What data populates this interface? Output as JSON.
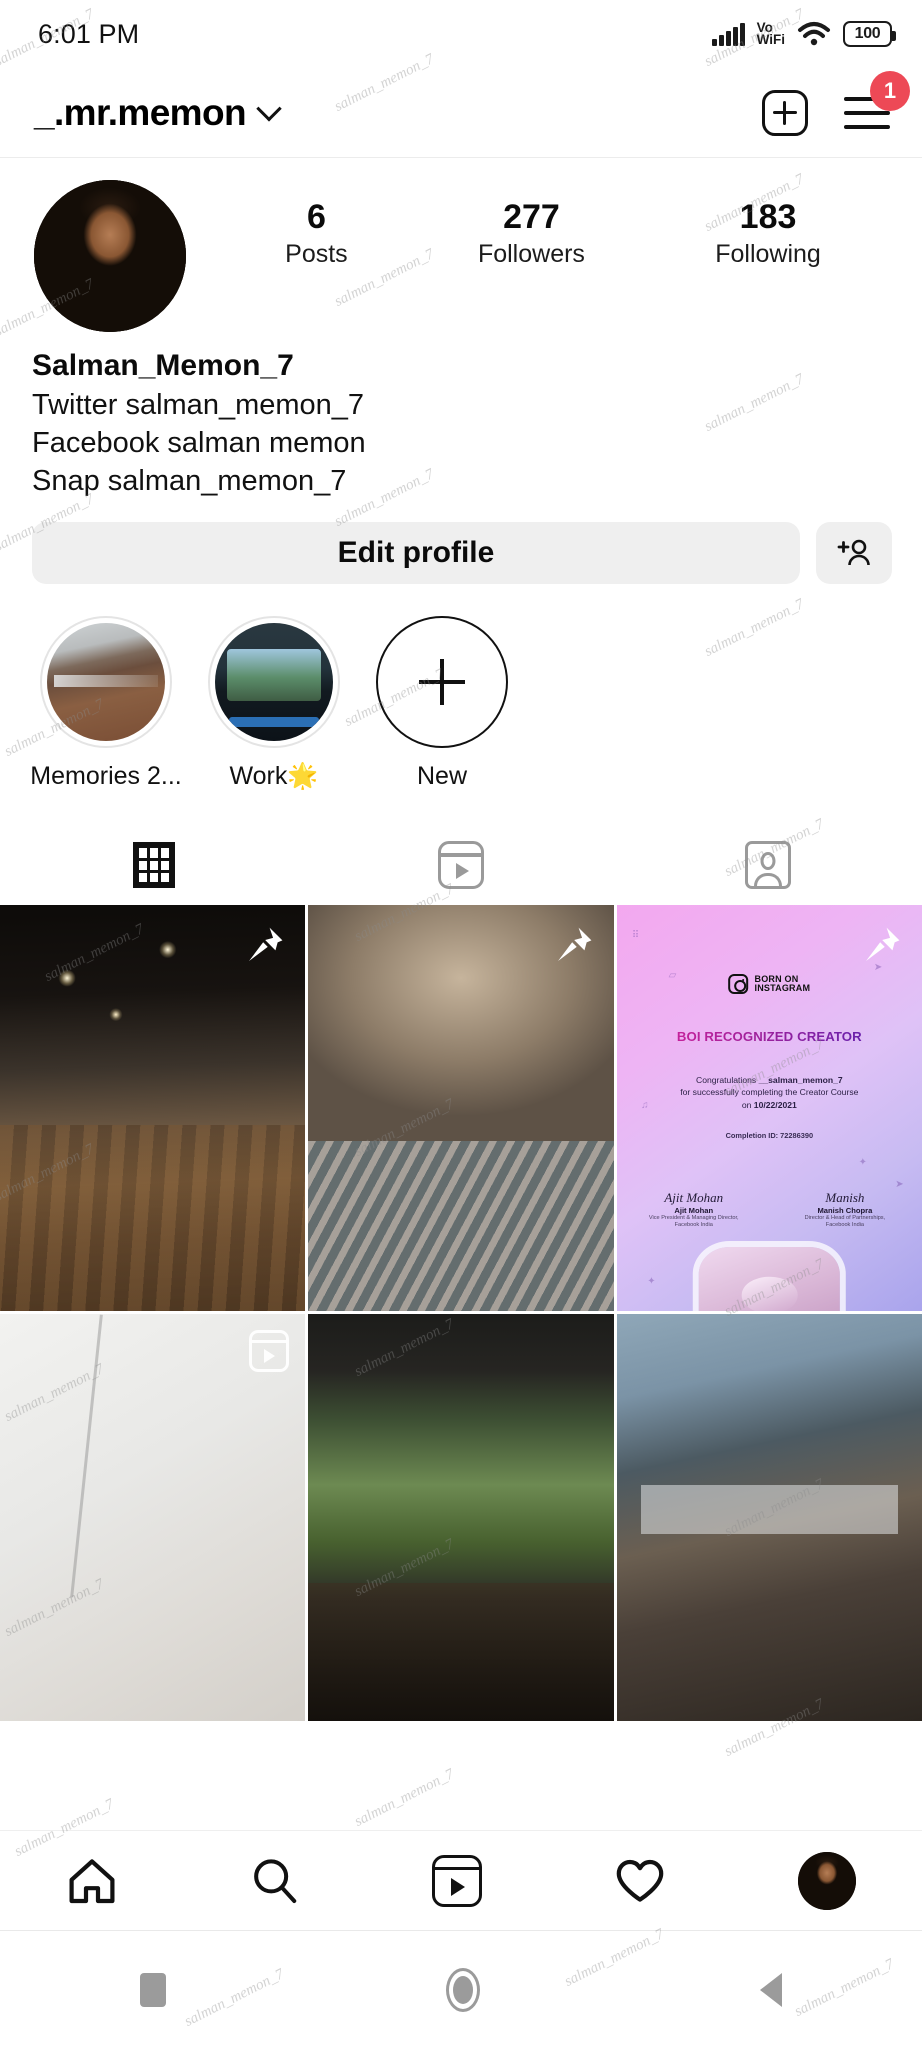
{
  "status_bar": {
    "time": "6:01 PM",
    "network_label": "Vo\nWiFi",
    "network_line1": "Vo",
    "network_line2": "WiFi",
    "battery_level": "100",
    "icons": [
      "signal-bars-icon",
      "vowifi-icon",
      "wifi-icon",
      "battery-icon"
    ]
  },
  "app_bar": {
    "username": "_.mr.memon",
    "chevron": "chevron-down-icon",
    "new_post_label": "new-post-icon",
    "menu_label": "hamburger-menu-icon",
    "menu_badge": "1",
    "badge_color": "#ED4956"
  },
  "profile": {
    "avatar_alt": "profile-avatar",
    "display_name": "Salman_Memon_7",
    "bio_lines": [
      "Twitter salman_memon_7",
      "Facebook salman memon",
      "Snap salman_memon_7"
    ],
    "stats": [
      {
        "value": "6",
        "label": "Posts"
      },
      {
        "value": "277",
        "label": "Followers"
      },
      {
        "value": "183",
        "label": "Following"
      }
    ],
    "edit_profile_label": "Edit profile",
    "add_person_label": "add-person-icon"
  },
  "highlights": [
    {
      "label": "Memories 2...",
      "type": "image"
    },
    {
      "label": "Work🌟",
      "type": "image"
    },
    {
      "label": "New",
      "type": "add"
    }
  ],
  "tabs": [
    {
      "name": "grid-tab",
      "icon": "grid-icon",
      "active": true
    },
    {
      "name": "reels-tab",
      "icon": "reels-icon",
      "active": false
    },
    {
      "name": "tagged-tab",
      "icon": "tagged-icon",
      "active": false
    }
  ],
  "posts": [
    {
      "id": 1,
      "pinned": true,
      "is_reel": false,
      "alt": "dark-bedroom-interior"
    },
    {
      "id": 2,
      "pinned": true,
      "is_reel": false,
      "alt": "stone-arch-pool-interior"
    },
    {
      "id": 3,
      "pinned": true,
      "is_reel": false,
      "alt": "instagram-creator-certificate"
    },
    {
      "id": 4,
      "pinned": false,
      "is_reel": true,
      "alt": "white-marble-surface"
    },
    {
      "id": 5,
      "pinned": false,
      "is_reel": false,
      "alt": "forest-view-living-room"
    },
    {
      "id": 6,
      "pinned": false,
      "is_reel": false,
      "alt": "modern-loft-interior"
    }
  ],
  "certificate": {
    "brand_line1": "BORN ON",
    "brand_line2": "INSTAGRAM",
    "title": "BOI RECOGNIZED CREATOR",
    "congrats_prefix": "Congratulations",
    "congrats_user": "__salman_memon_7",
    "body_line": "for successfully completing the Creator Course",
    "date_prefix": "on",
    "date": "10/22/2021",
    "completion_id": "Completion ID: 72286390",
    "signatories": [
      {
        "signature": "Ajit Mohan",
        "name": "Ajit Mohan",
        "role_line1": "Vice President & Managing Director,",
        "role_line2": "Facebook India"
      },
      {
        "signature": "Manish",
        "name": "Manish Chopra",
        "role_line1": "Director & Head of Partnerships,",
        "role_line2": "Facebook India"
      }
    ]
  },
  "bottom_nav": [
    {
      "name": "nav-home",
      "icon": "home-icon",
      "active": true
    },
    {
      "name": "nav-search",
      "icon": "search-icon",
      "active": false
    },
    {
      "name": "nav-reels",
      "icon": "reels-icon",
      "active": false
    },
    {
      "name": "nav-activity",
      "icon": "heart-icon",
      "active": false
    },
    {
      "name": "nav-profile",
      "icon": "avatar-icon",
      "active": false
    }
  ],
  "system_nav": [
    {
      "name": "recents-button",
      "icon": "square-icon"
    },
    {
      "name": "home-button",
      "icon": "circle-icon"
    },
    {
      "name": "back-button",
      "icon": "triangle-back-icon"
    }
  ],
  "watermark": {
    "text": "salman_memon_7"
  },
  "colors": {
    "accent_red": "#ED4956",
    "button_grey": "#efefef",
    "text_primary": "#0b0b0b",
    "inactive_grey": "#9a9a9a"
  }
}
